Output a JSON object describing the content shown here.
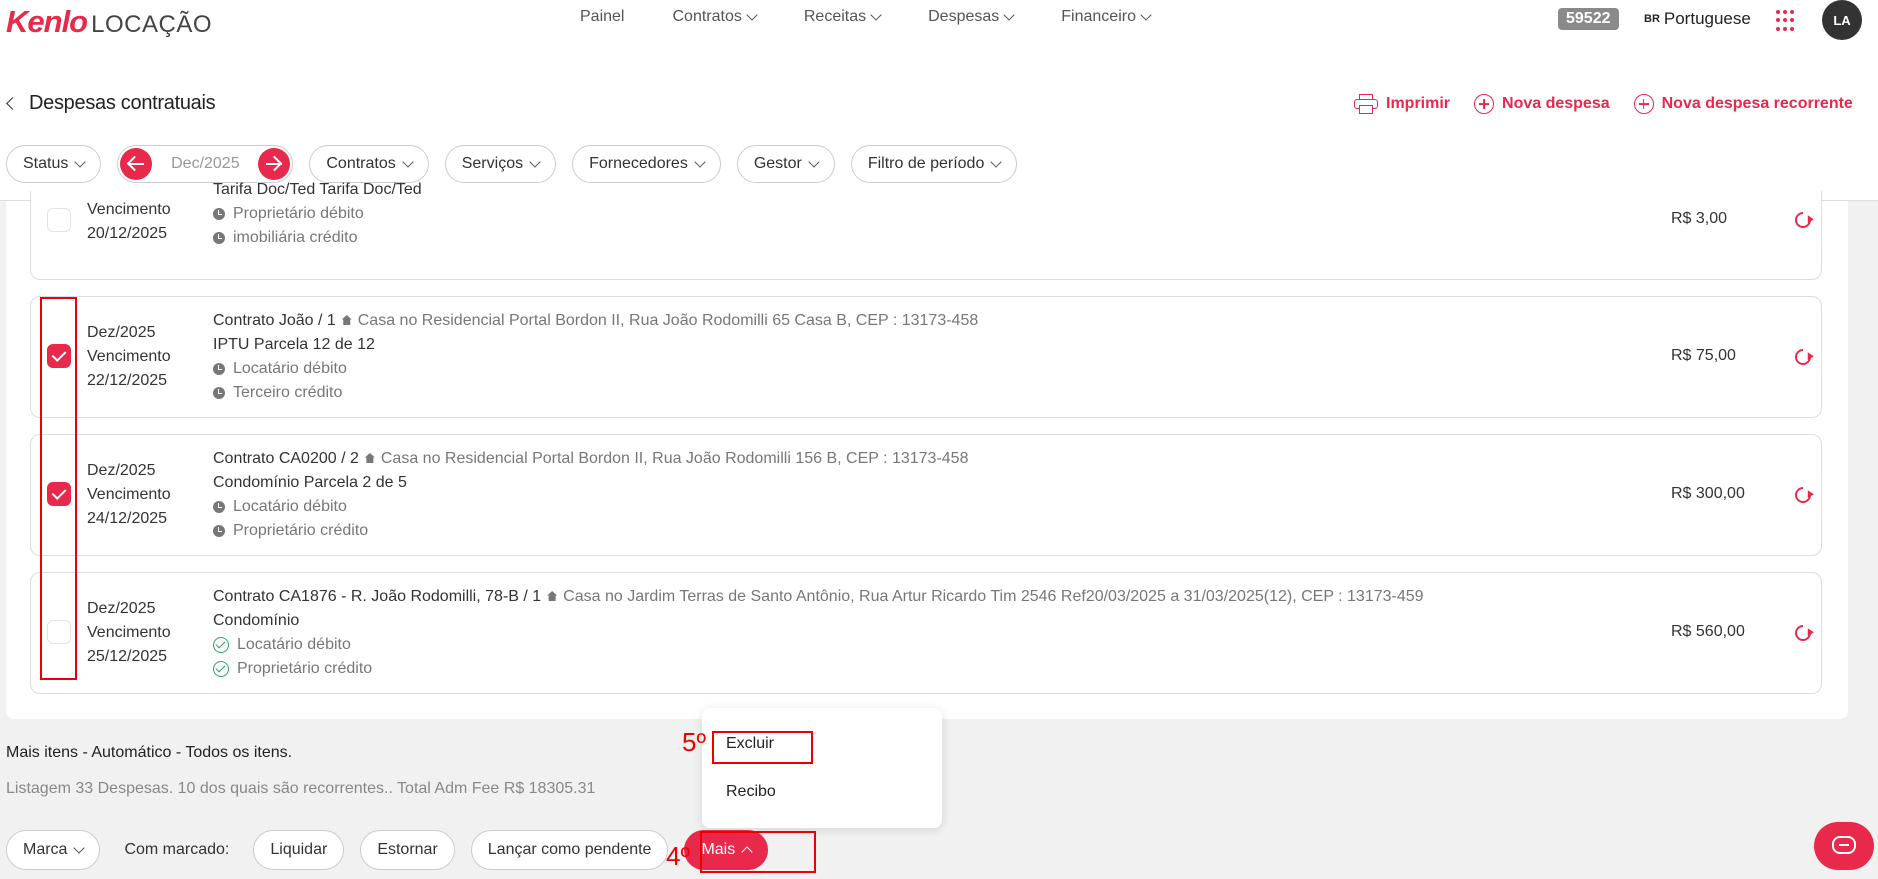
{
  "brand": {
    "logo_kenlo": "Kenlo",
    "logo_suffix": "LOCAÇÃO"
  },
  "nav": [
    {
      "label": "Painel",
      "dropdown": false
    },
    {
      "label": "Contratos",
      "dropdown": true
    },
    {
      "label": "Receitas",
      "dropdown": true
    },
    {
      "label": "Despesas",
      "dropdown": true
    },
    {
      "label": "Financeiro",
      "dropdown": true
    }
  ],
  "topright": {
    "badge": "59522",
    "lang_flag": "BR",
    "lang_label": "Portuguese",
    "avatar": "LA"
  },
  "page": {
    "title": "Despesas contratuais",
    "actions": {
      "print": "Imprimir",
      "new": "Nova despesa",
      "new_recurring": "Nova despesa recorrente"
    }
  },
  "filters": {
    "status": "Status",
    "period": "Dec/2025",
    "contracts": "Contratos",
    "services": "Serviços",
    "suppliers": "Fornecedores",
    "manager": "Gestor",
    "period_filter": "Filtro de período"
  },
  "rows": [
    {
      "month": "",
      "due_label": "Vencimento",
      "due": "20/12/2025",
      "contract": "",
      "address": "",
      "item": "Tarifa Doc/Ted Tarifa Doc/Ted",
      "debit": "Proprietário débito",
      "credit": "imobiliária crédito",
      "amount": "R$ 3,00",
      "checked": false
    },
    {
      "month": "Dez/2025",
      "due_label": "Vencimento",
      "due": "22/12/2025",
      "contract": "Contrato João / 1",
      "address": "Casa no Residencial Portal Bordon II, Rua João Rodomilli 65 Casa B, CEP : 13173-458",
      "item": "IPTU Parcela 12 de 12",
      "debit": "Locatário débito",
      "credit": "Terceiro crédito",
      "amount": "R$ 75,00",
      "checked": true
    },
    {
      "month": "Dez/2025",
      "due_label": "Vencimento",
      "due": "24/12/2025",
      "contract": "Contrato CA0200 / 2",
      "address": "Casa no Residencial Portal Bordon II, Rua João Rodomilli 156 B, CEP : 13173-458",
      "item": "Condomínio Parcela 2 de 5",
      "debit": "Locatário débito",
      "credit": "Proprietário crédito",
      "amount": "R$ 300,00",
      "checked": true
    },
    {
      "month": "Dez/2025",
      "due_label": "Vencimento",
      "due": "25/12/2025",
      "contract": "Contrato CA1876 - R. João Rodomilli, 78-B / 1",
      "address": "Casa no Jardim Terras de Santo Antônio, Rua Artur Ricardo Tim 2546 Ref20/03/2025 a 31/03/2025(12), CEP : 13173-459",
      "item": "Condomínio",
      "debit": "Locatário débito",
      "credit": "Proprietário crédito",
      "amount": "R$ 560,00",
      "checked": false
    }
  ],
  "summary": {
    "more_items": "Mais itens - Automático - Todos os itens.",
    "listing": "Listagem 33 Despesas. 10 dos quais são recorrentes.. Total Adm Fee R$ 18305.31"
  },
  "bottom": {
    "mark": "Marca",
    "with_marked": "Com marcado:",
    "settle": "Liquidar",
    "reverse": "Estornar",
    "set_pending": "Lançar como pendente",
    "more": "Mais"
  },
  "dropdown": {
    "delete": "Excluir",
    "receipt": "Recibo"
  },
  "annotations": {
    "step4": "4º",
    "step5": "5º"
  },
  "colors": {
    "accent": "#e8294c",
    "highlight": "#e00000",
    "ok": "#2aa65c"
  }
}
